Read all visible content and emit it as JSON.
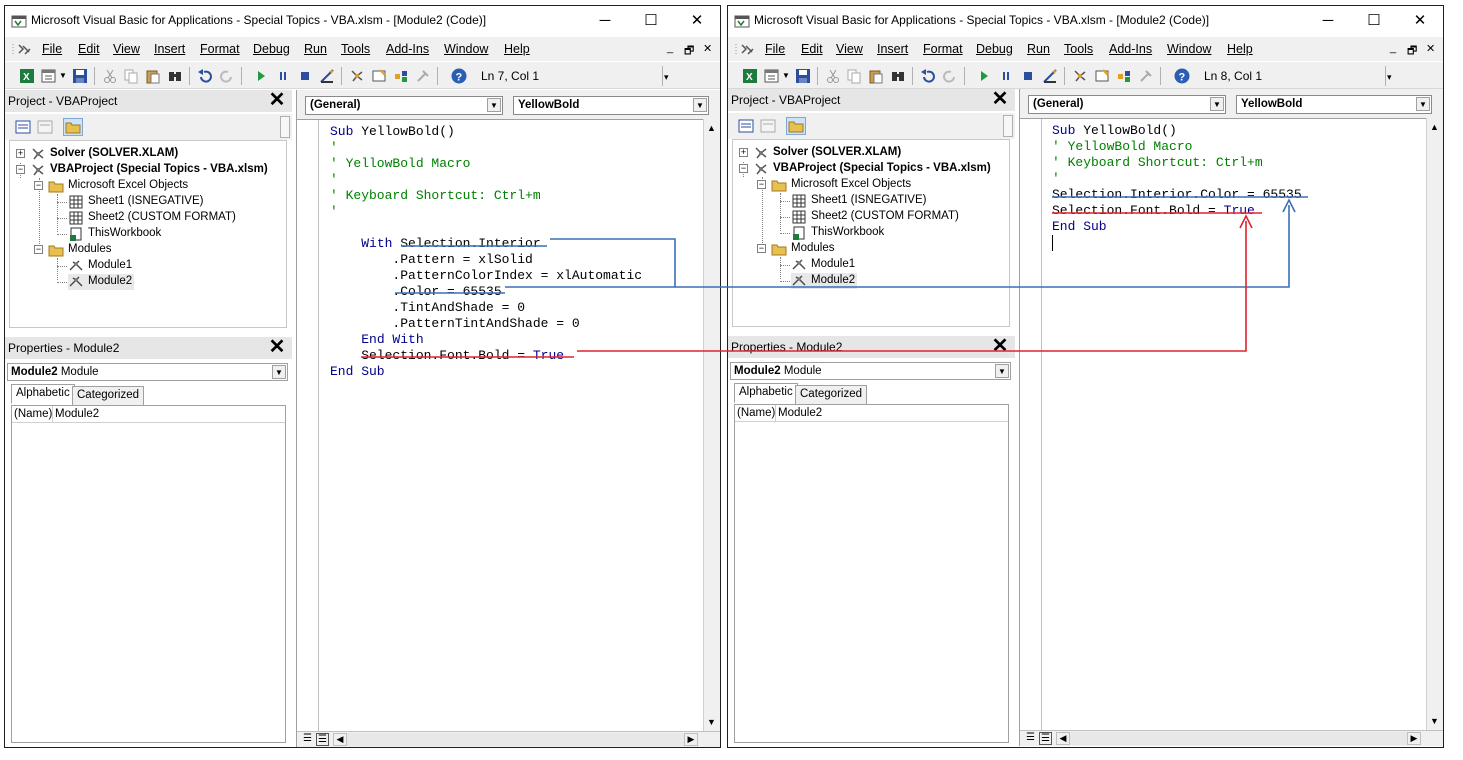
{
  "colors": {
    "blue_annotation": "#3b6fb6",
    "red_annotation": "#e0232d",
    "keyword": "#00008b",
    "comment": "#008000"
  },
  "windows": [
    {
      "title": "Microsoft Visual Basic for Applications - Special Topics - VBA.xlsm - [Module2 (Code)]",
      "menu": [
        "File",
        "Edit",
        "View",
        "Insert",
        "Format",
        "Debug",
        "Run",
        "Tools",
        "Add-Ins",
        "Window",
        "Help"
      ],
      "status": "Ln 7, Col 1",
      "project_title": "Project - VBAProject",
      "tree": {
        "solver": "Solver (SOLVER.XLAM)",
        "vbaproject": "VBAProject (Special Topics - VBA.xlsm)",
        "excel_objects": "Microsoft Excel Objects",
        "sheet1": "Sheet1 (ISNEGATIVE)",
        "sheet2": "Sheet2 (CUSTOM FORMAT)",
        "thisworkbook": "ThisWorkbook",
        "modules": "Modules",
        "module1": "Module1",
        "module2": "Module2"
      },
      "properties_title": "Properties - Module2",
      "object_name": "Module2",
      "object_type": "Module",
      "tabs": [
        "Alphabetic",
        "Categorized"
      ],
      "prop_name": "(Name)",
      "prop_value": "Module2",
      "combo_left": "(General)",
      "combo_right": "YellowBold",
      "code": [
        "Sub YellowBold()",
        "'",
        "' YellowBold Macro",
        "'",
        "' Keyboard Shortcut: Ctrl+m",
        "'",
        "",
        "    With Selection.Interior",
        "        .Pattern = xlSolid",
        "        .PatternColorIndex = xlAutomatic",
        "        .Color = 65535",
        "        .TintAndShade = 0",
        "        .PatternTintAndShade = 0",
        "    End With",
        "    Selection.Font.Bold = True",
        "End Sub"
      ]
    },
    {
      "title": "Microsoft Visual Basic for Applications - Special Topics - VBA.xlsm - [Module2 (Code)]",
      "menu": [
        "File",
        "Edit",
        "View",
        "Insert",
        "Format",
        "Debug",
        "Run",
        "Tools",
        "Add-Ins",
        "Window",
        "Help"
      ],
      "status": "Ln 8, Col 1",
      "project_title": "Project - VBAProject",
      "tree": {
        "solver": "Solver (SOLVER.XLAM)",
        "vbaproject": "VBAProject (Special Topics - VBA.xlsm)",
        "excel_objects": "Microsoft Excel Objects",
        "sheet1": "Sheet1 (ISNEGATIVE)",
        "sheet2": "Sheet2 (CUSTOM FORMAT)",
        "thisworkbook": "ThisWorkbook",
        "modules": "Modules",
        "module1": "Module1",
        "module2": "Module2"
      },
      "properties_title": "Properties - Module2",
      "object_name": "Module2",
      "object_type": "Module",
      "tabs": [
        "Alphabetic",
        "Categorized"
      ],
      "prop_name": "(Name)",
      "prop_value": "Module2",
      "combo_left": "(General)",
      "combo_right": "YellowBold",
      "code": [
        "Sub YellowBold()",
        "' YellowBold Macro",
        "' Keyboard Shortcut: Ctrl+m",
        "'",
        "Selection.Interior.Color = 65535",
        "Selection.Font.Bold = True",
        "End Sub"
      ]
    }
  ]
}
